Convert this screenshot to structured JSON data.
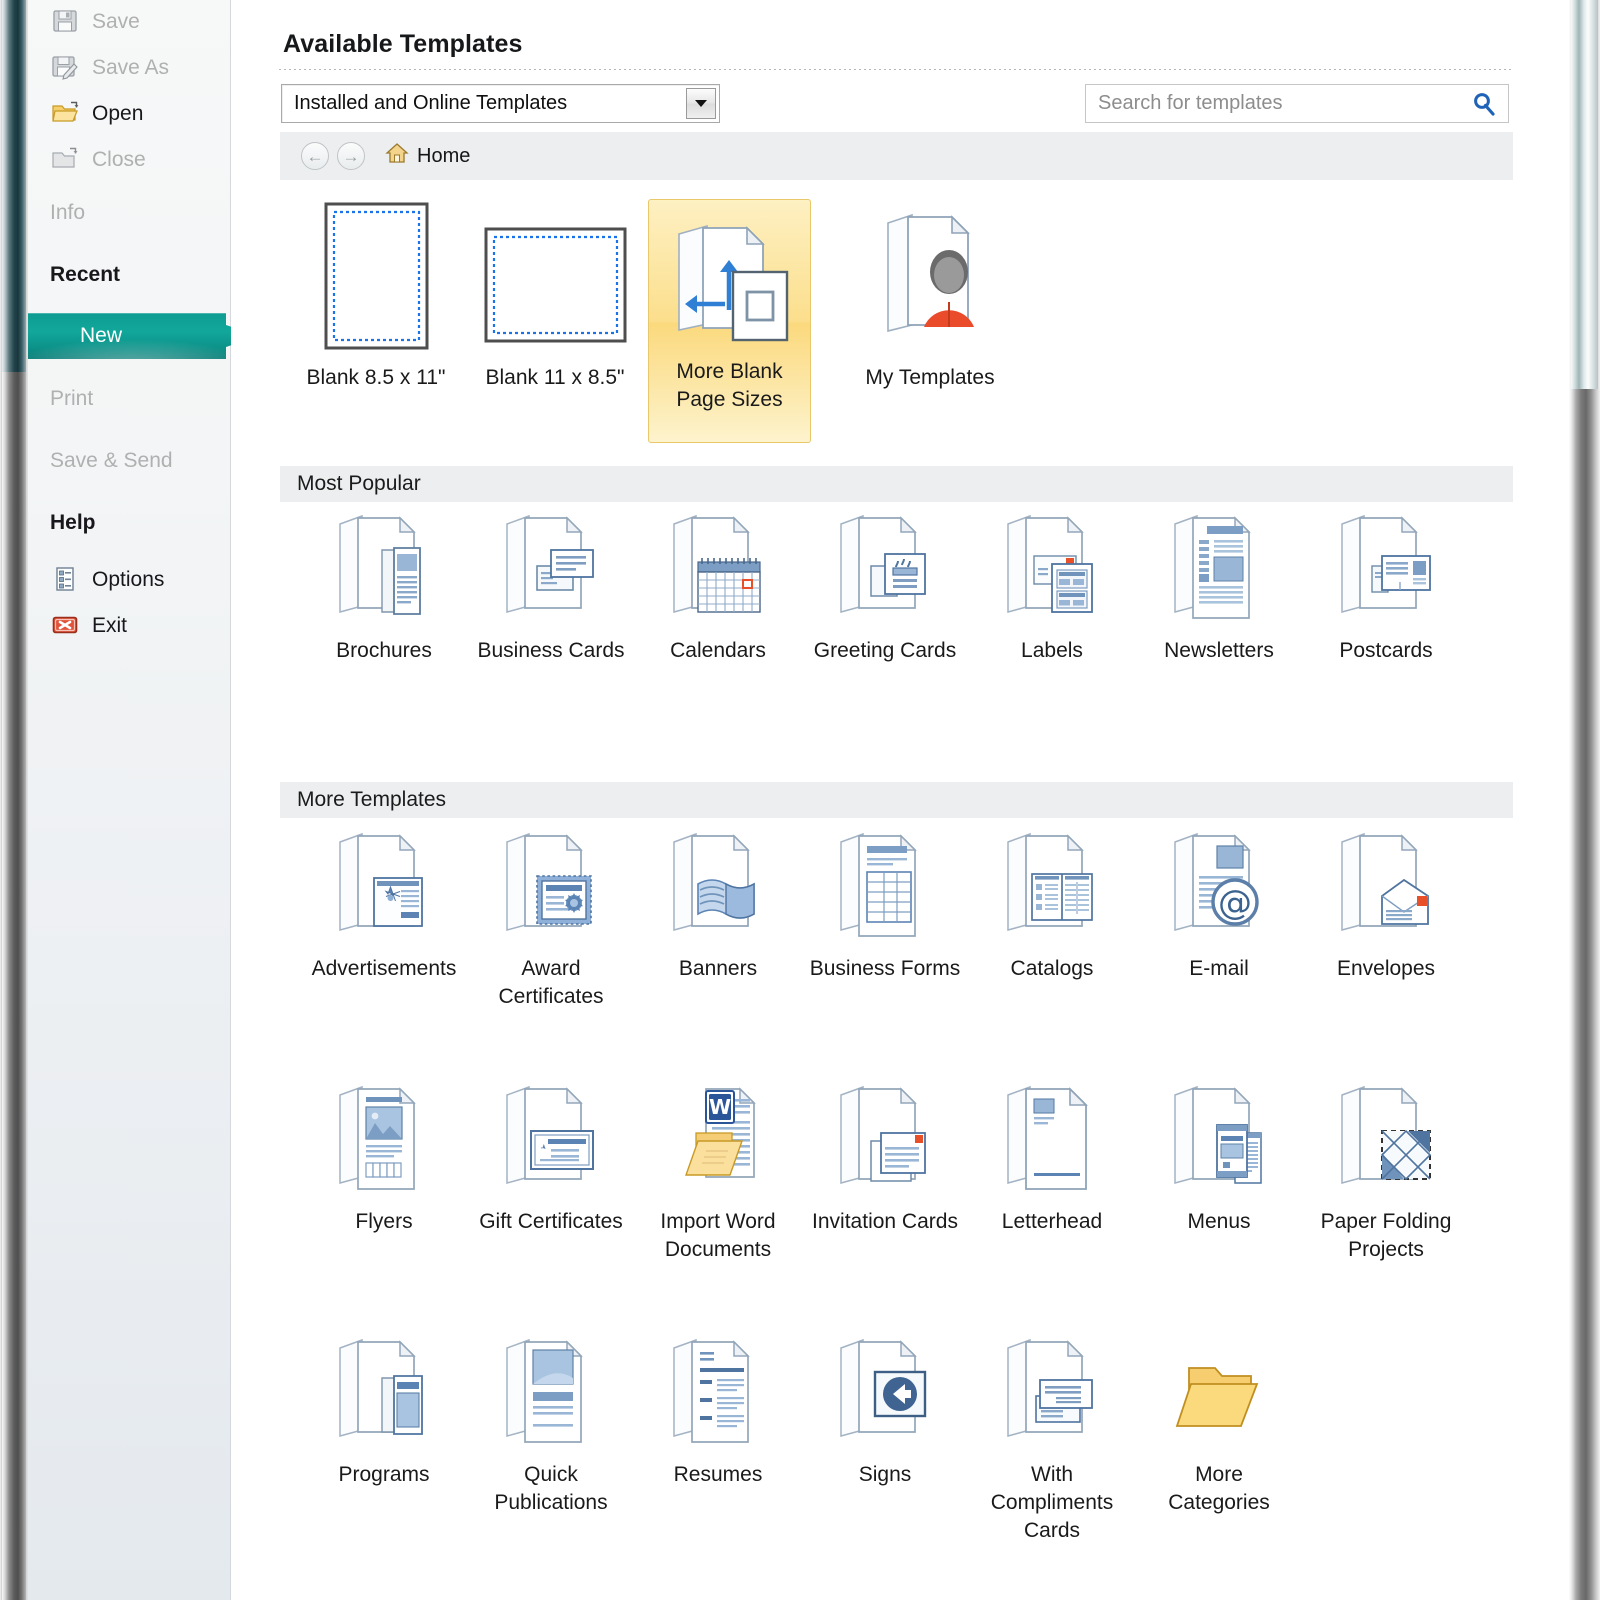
{
  "window": {
    "app": "Microsoft Publisher 2010 Backstage",
    "accent_color": "#12a79b",
    "selected_tile_color": "#fbd97d"
  },
  "sidebar": {
    "items": [
      {
        "label": "Save",
        "icon": "save-icon",
        "state": "disabled"
      },
      {
        "label": "Save As",
        "icon": "save-as-icon",
        "state": "disabled"
      },
      {
        "label": "Open",
        "icon": "open-folder-icon",
        "state": "enabled"
      },
      {
        "label": "Close",
        "icon": "close-folder-icon",
        "state": "disabled"
      },
      {
        "label": "Info",
        "icon": "none",
        "state": "disabled"
      },
      {
        "label": "Recent",
        "icon": "none",
        "state": "enabled"
      },
      {
        "label": "New",
        "icon": "none",
        "state": "selected"
      },
      {
        "label": "Print",
        "icon": "none",
        "state": "disabled"
      },
      {
        "label": "Save & Send",
        "icon": "none",
        "state": "disabled"
      },
      {
        "label": "Help",
        "icon": "none",
        "state": "enabled"
      },
      {
        "label": "Options",
        "icon": "options-icon",
        "state": "enabled"
      },
      {
        "label": "Exit",
        "icon": "exit-icon",
        "state": "enabled"
      }
    ]
  },
  "main": {
    "title": "Available Templates",
    "source_select": {
      "value": "Installed and Online Templates",
      "caret_icon": "chevron-down-icon"
    },
    "search": {
      "placeholder": "Search for templates",
      "value": "",
      "icon": "search-icon"
    },
    "breadcrumb": {
      "back_icon": "arrow-left-icon",
      "forward_icon": "arrow-right-icon",
      "home_icon": "home-icon",
      "home_label": "Home"
    },
    "blank_row": [
      {
        "label": "Blank 8.5 x 11\"",
        "icon": "blank-portrait-page-icon",
        "selected": false
      },
      {
        "label": "Blank 11 x 8.5\"",
        "icon": "blank-landscape-page-icon",
        "selected": false
      },
      {
        "label": "More Blank\nPage Sizes",
        "icon": "more-page-sizes-icon",
        "selected": true
      },
      {
        "label": "My Templates",
        "icon": "my-templates-icon",
        "selected": false
      }
    ],
    "sections": [
      {
        "heading": "Most Popular",
        "items": [
          {
            "label": "Brochures",
            "icon": "brochures-icon"
          },
          {
            "label": "Business Cards",
            "icon": "business-cards-icon"
          },
          {
            "label": "Calendars",
            "icon": "calendars-icon"
          },
          {
            "label": "Greeting Cards",
            "icon": "greeting-cards-icon"
          },
          {
            "label": "Labels",
            "icon": "labels-icon"
          },
          {
            "label": "Newsletters",
            "icon": "newsletters-icon"
          },
          {
            "label": "Postcards",
            "icon": "postcards-icon"
          }
        ]
      },
      {
        "heading": "More Templates",
        "items": [
          {
            "label": "Advertisements",
            "icon": "advertisements-icon"
          },
          {
            "label": "Award\nCertificates",
            "icon": "award-certificates-icon"
          },
          {
            "label": "Banners",
            "icon": "banners-icon"
          },
          {
            "label": "Business Forms",
            "icon": "business-forms-icon"
          },
          {
            "label": "Catalogs",
            "icon": "catalogs-icon"
          },
          {
            "label": "E-mail",
            "icon": "email-icon"
          },
          {
            "label": "Envelopes",
            "icon": "envelopes-icon"
          },
          {
            "label": "Flyers",
            "icon": "flyers-icon"
          },
          {
            "label": "Gift Certificates",
            "icon": "gift-certificates-icon"
          },
          {
            "label": "Import Word\nDocuments",
            "icon": "import-word-documents-icon"
          },
          {
            "label": "Invitation Cards",
            "icon": "invitation-cards-icon"
          },
          {
            "label": "Letterhead",
            "icon": "letterhead-icon"
          },
          {
            "label": "Menus",
            "icon": "menus-icon"
          },
          {
            "label": "Paper Folding\nProjects",
            "icon": "paper-folding-projects-icon"
          },
          {
            "label": "Programs",
            "icon": "programs-icon"
          },
          {
            "label": "Quick\nPublications",
            "icon": "quick-publications-icon"
          },
          {
            "label": "Resumes",
            "icon": "resumes-icon"
          },
          {
            "label": "Signs",
            "icon": "signs-icon"
          },
          {
            "label": "With\nCompliments\nCards",
            "icon": "with-compliments-cards-icon"
          },
          {
            "label": "More\nCategories",
            "icon": "more-categories-folder-icon"
          }
        ]
      }
    ]
  }
}
